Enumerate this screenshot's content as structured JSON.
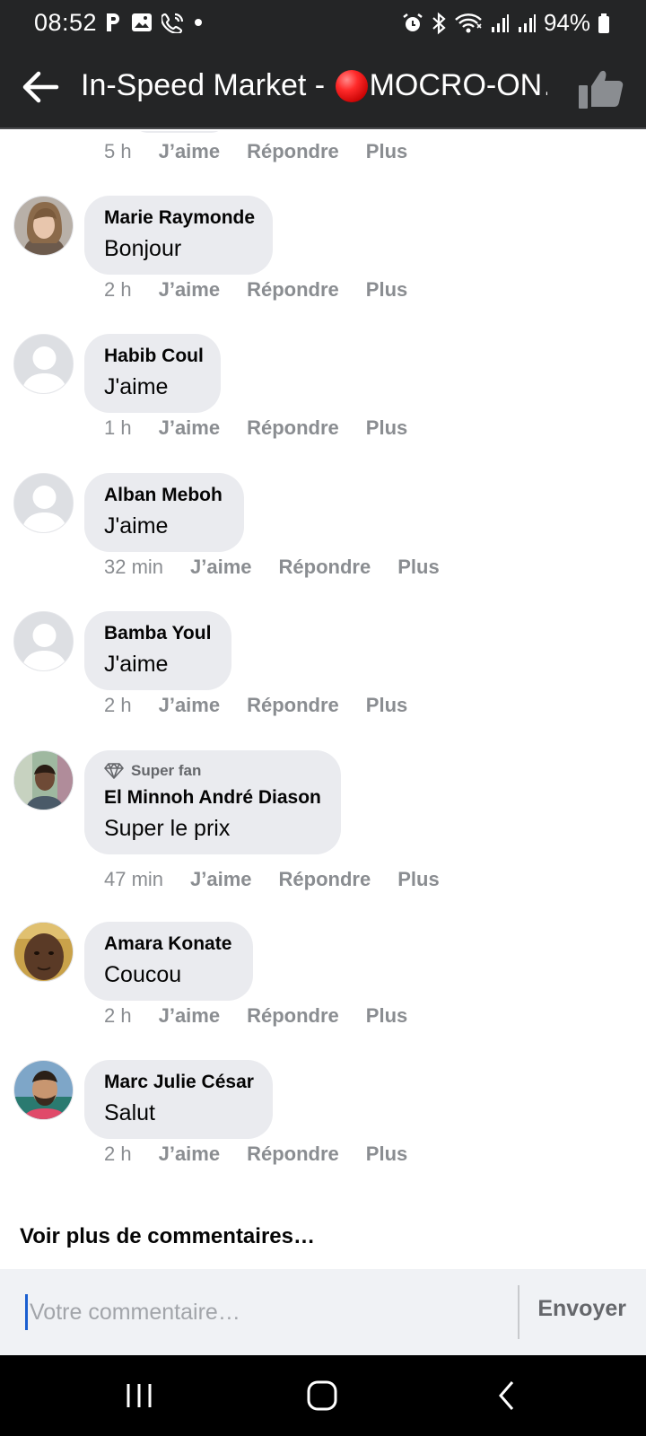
{
  "status_bar": {
    "time": "08:52",
    "battery": "94%",
    "icons": [
      "parking-icon",
      "gallery-icon",
      "wifi-call-icon",
      "dot-icon",
      "alarm-icon",
      "bluetooth-icon",
      "wifi-icon",
      "signal-icon",
      "signal-icon",
      "battery-icon"
    ]
  },
  "header": {
    "title_prefix": "In-Speed Market - ",
    "title_suffix": "MOCRO-ON…",
    "back_icon": "arrow-left-icon",
    "like_icon": "thumbs-up-icon"
  },
  "partial_comment": {
    "time": "5 h",
    "like": "J’aime",
    "reply": "Répondre",
    "more": "Plus"
  },
  "comments": [
    {
      "author": "Marie Raymonde",
      "text": "Bonjour",
      "time": "2 h",
      "like": "J’aime",
      "reply": "Répondre",
      "more": "Plus"
    },
    {
      "author": "Habib Coul",
      "text": "J'aime",
      "time": "1 h",
      "like": "J’aime",
      "reply": "Répondre",
      "more": "Plus"
    },
    {
      "author": "Alban Meboh",
      "text": "J'aime",
      "time": "32 min",
      "like": "J’aime",
      "reply": "Répondre",
      "more": "Plus"
    },
    {
      "author": "Bamba Youl",
      "text": "J'aime",
      "time": "2 h",
      "like": "J’aime",
      "reply": "Répondre",
      "more": "Plus"
    },
    {
      "badge": "Super fan",
      "author": "El Minnoh André Diason",
      "text": "Super le prix",
      "time": "47 min",
      "like": "J’aime",
      "reply": "Répondre",
      "more": "Plus"
    },
    {
      "author": "Amara Konate",
      "text": "Coucou",
      "time": "2 h",
      "like": "J’aime",
      "reply": "Répondre",
      "more": "Plus"
    },
    {
      "author": "Marc Julie César",
      "text": "Salut",
      "time": "2 h",
      "like": "J’aime",
      "reply": "Répondre",
      "more": "Plus"
    }
  ],
  "see_more": "Voir plus de commentaires…",
  "composer": {
    "placeholder": "Votre commentaire…",
    "value": "",
    "send_label": "Envoyer"
  },
  "nav_bar": {
    "icons": [
      "recent-apps-icon",
      "home-icon",
      "back-icon"
    ]
  },
  "colors": {
    "header_bg": "#242526",
    "bubble_bg": "#eaebef",
    "meta_text": "#8a8d91",
    "composer_bg": "#f0f2f5",
    "live_dot": "#e11c1c"
  }
}
